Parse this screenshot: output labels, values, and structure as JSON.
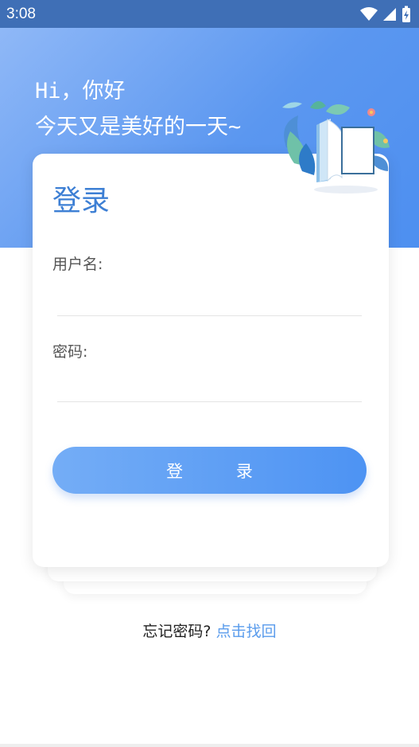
{
  "status_bar": {
    "time": "3:08",
    "icons": [
      "wifi-icon",
      "signal-icon",
      "battery-icon"
    ]
  },
  "hero": {
    "greeting_line1": "Hi，你好",
    "greeting_line2": "今天又是美好的一天~"
  },
  "login": {
    "title": "登录",
    "username_label": "用户名:",
    "username_value": "",
    "password_label": "密码:",
    "password_value": "",
    "submit_label": "登 录"
  },
  "footer": {
    "forgot_text": "忘记密码?",
    "forgot_link": "点击找回"
  },
  "colors": {
    "accent": "#4d8ff0",
    "title_blue": "#3d7fd4",
    "link_blue": "#5a9cec",
    "status_bar": "#3f6fb6"
  }
}
